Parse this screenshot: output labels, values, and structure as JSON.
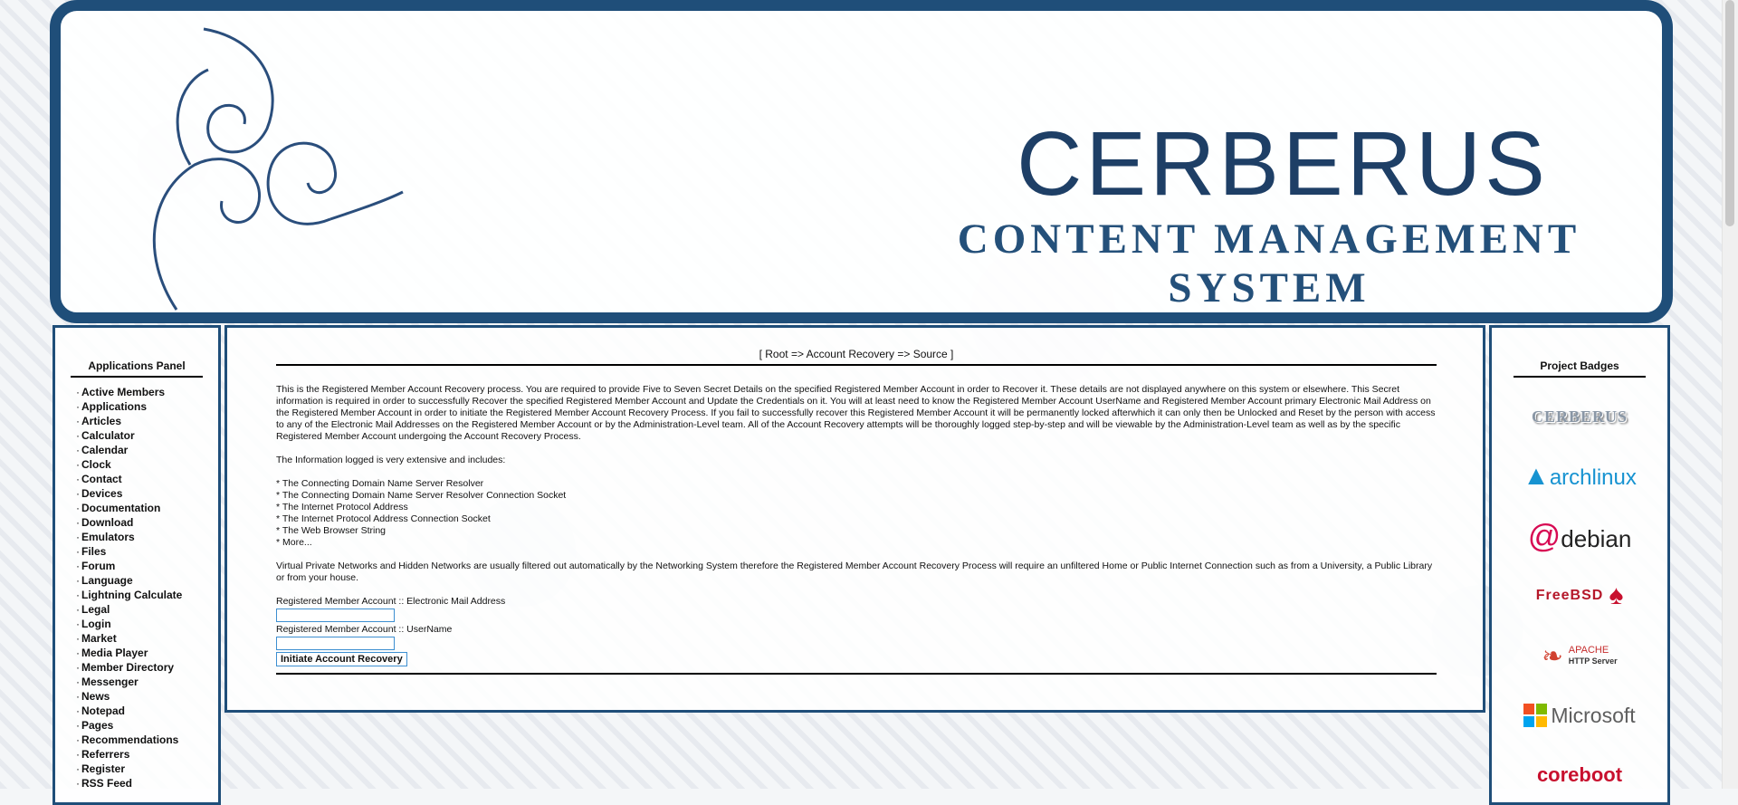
{
  "banner": {
    "title": "CERBERUS",
    "subtitle": "CONTENT MANAGEMENT SYSTEM"
  },
  "left_panel": {
    "heading": "Applications Panel",
    "items": [
      "Active Members",
      "Applications",
      "Articles",
      "Calculator",
      "Calendar",
      "Clock",
      "Contact",
      "Devices",
      "Documentation",
      "Download",
      "Emulators",
      "Files",
      "Forum",
      "Language",
      "Lightning Calculate",
      "Legal",
      "Login",
      "Market",
      "Media Player",
      "Member Directory",
      "Messenger",
      "News",
      "Notepad",
      "Pages",
      "Recommendations",
      "Referrers",
      "Register",
      "RSS Feed"
    ]
  },
  "main": {
    "breadcrumb": "[ Root => Account Recovery => Source ]",
    "paragraph1": "This is the Registered Member Account Recovery process. You are required to provide Five to Seven Secret Details on the specified Registered Member Account in order to Recover it. These details are not displayed anywhere on this system or elsewhere. This Secret information is required in order to successfully Recover the specified Registered Member Account and Update the Credentials on it. You will at least need to know the Registered Member Account UserName and Registered Member Account primary Electronic Mail Address on the Registered Member Account in order to initiate the Registered Member Account Recovery Process. If you fail to successfully recover this Registered Member Account it will be permanently locked afterwhich it can only then be Unlocked and Reset by the person with access to any of the Electronic Mail Addresses on the Registered Member Account or by the Administration-Level team. All of the Account Recovery attempts will be thoroughly logged step-by-step and will be viewable by the Administration-Level team as well as by the specific Registered Member Account undergoing the Account Recovery Process.",
    "paragraph2": "The Information logged is very extensive and includes:",
    "logged_items": [
      "* The Connecting Domain Name Server Resolver",
      "* The Connecting Domain Name Server Resolver Connection Socket",
      "* The Internet Protocol Address",
      "* The Internet Protocol Address Connection Socket",
      "* The Web Browser String",
      "* More..."
    ],
    "paragraph3": "Virtual Private Networks and Hidden Networks are usually filtered out automatically by the Networking System therefore the Registered Member Account Recovery Process will require an unfiltered Home or Public Internet Connection such as from a University, a Public Library or from your house.",
    "email_label": "Registered Member Account :: Electronic Mail Address",
    "email_value": "",
    "username_label": "Registered Member Account :: UserName",
    "username_value": "",
    "submit_label": "Initiate Account Recovery"
  },
  "right_panel": {
    "heading": "Project Badges",
    "badges": {
      "cerberus": "CERBERUS",
      "arch": "archlinux",
      "debian": "debian",
      "freebsd": "FreeBSD",
      "apache_top": "APACHE",
      "apache_bottom": "HTTP Server",
      "microsoft": "Microsoft",
      "coreboot": "coreboot"
    }
  },
  "colors": {
    "frame": "#1f4e79",
    "title": "#1e3f66",
    "input_border": "#3d8fd1"
  }
}
